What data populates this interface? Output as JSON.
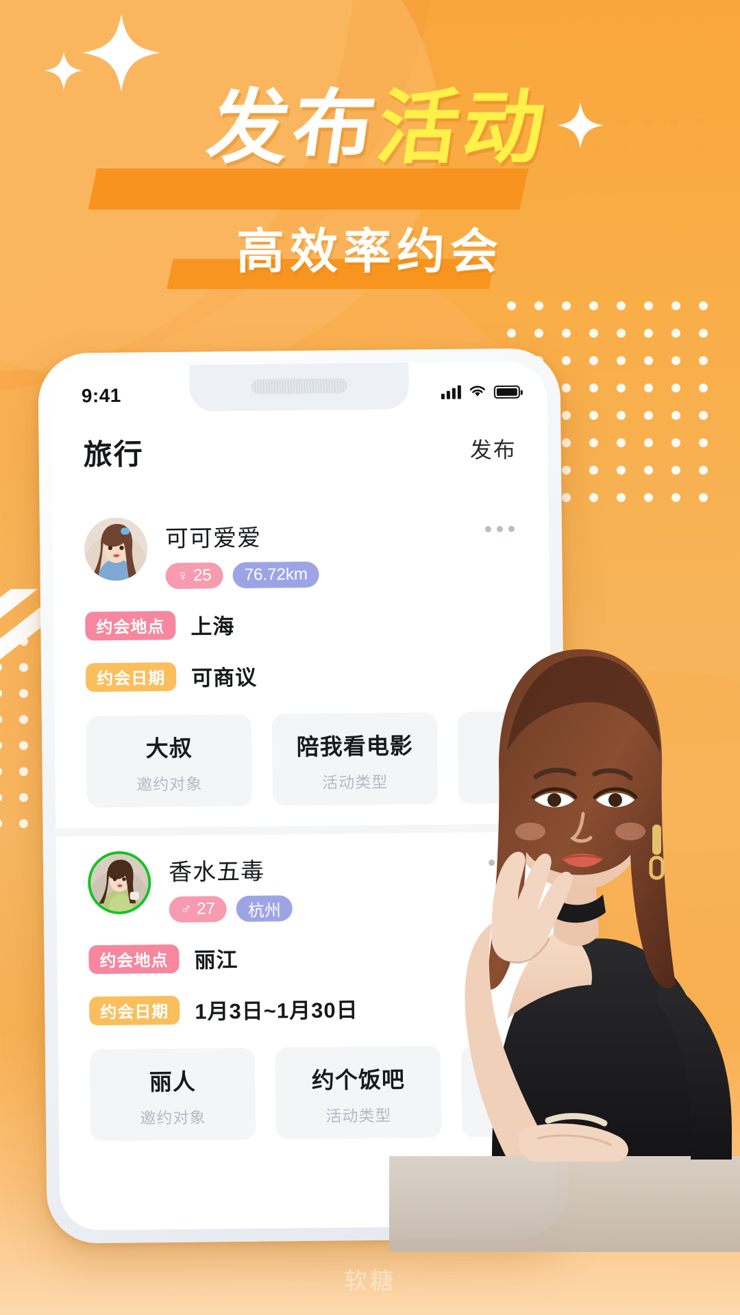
{
  "poster": {
    "headline_white": "发布",
    "headline_yellow": "活动",
    "subtitle": "高效率约会",
    "watermark": "软糖",
    "accent_orange": "#F7931E",
    "accent_yellow": "#FFF04A",
    "background": "#F9A945"
  },
  "phone": {
    "statusbar": {
      "time": "9:41",
      "signal_icon": "signal-bars-icon",
      "wifi_icon": "wifi-icon",
      "battery_icon": "battery-full-icon"
    },
    "nav": {
      "title": "旅行",
      "action": "发布"
    },
    "feed": {
      "labels": {
        "location": "约会地点",
        "date": "约会日期",
        "target_caption": "邀约对象",
        "activity_caption": "活动类型"
      },
      "cards": [
        {
          "name": "可可爱爱",
          "gender_glyph": "♀",
          "age": "25",
          "distance": "76.72km",
          "more_icon": "more-horizontal-icon",
          "location": "上海",
          "date": "可商议",
          "target": "大叔",
          "activity": "陪我看电影",
          "avatar_ring": false
        },
        {
          "name": "香水五毒",
          "gender_glyph": "♂",
          "age": "27",
          "distance": "杭州",
          "more_icon": "more-horizontal-icon",
          "location": "丽江",
          "date": "1月3日~1月30日",
          "target": "丽人",
          "activity": "约个饭吧",
          "avatar_ring": true
        }
      ]
    }
  }
}
